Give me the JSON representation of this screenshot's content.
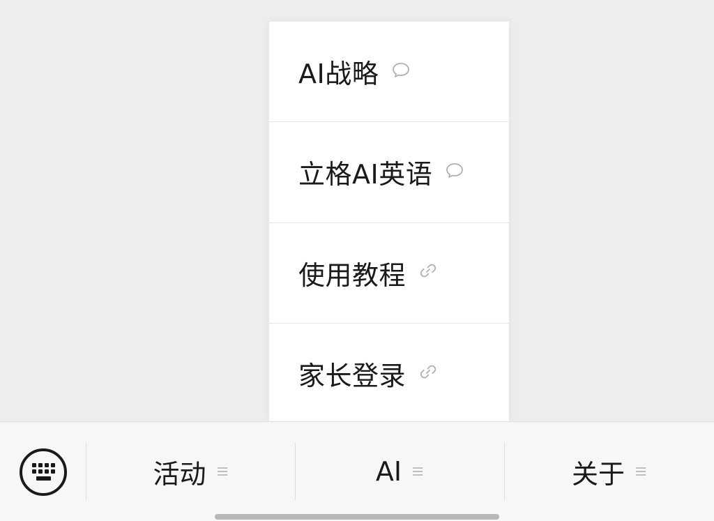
{
  "popup_menu": {
    "items": [
      {
        "label": "AI战略",
        "icon": "chat-bubble-icon"
      },
      {
        "label": "立格AI英语",
        "icon": "chat-bubble-icon"
      },
      {
        "label": "使用教程",
        "icon": "link-icon"
      },
      {
        "label": "家长登录",
        "icon": "link-icon"
      }
    ]
  },
  "bottom_bar": {
    "keyboard_icon": "keyboard-icon",
    "tabs": [
      {
        "label": "活动",
        "icon": "menu-lines-icon"
      },
      {
        "label": "AI",
        "icon": "menu-lines-icon"
      },
      {
        "label": "关于",
        "icon": "menu-lines-icon"
      }
    ]
  },
  "colors": {
    "background": "#ededed",
    "menu_bg": "#ffffff",
    "text": "#1a1a1a",
    "icon_gray": "#b0b0b0"
  }
}
